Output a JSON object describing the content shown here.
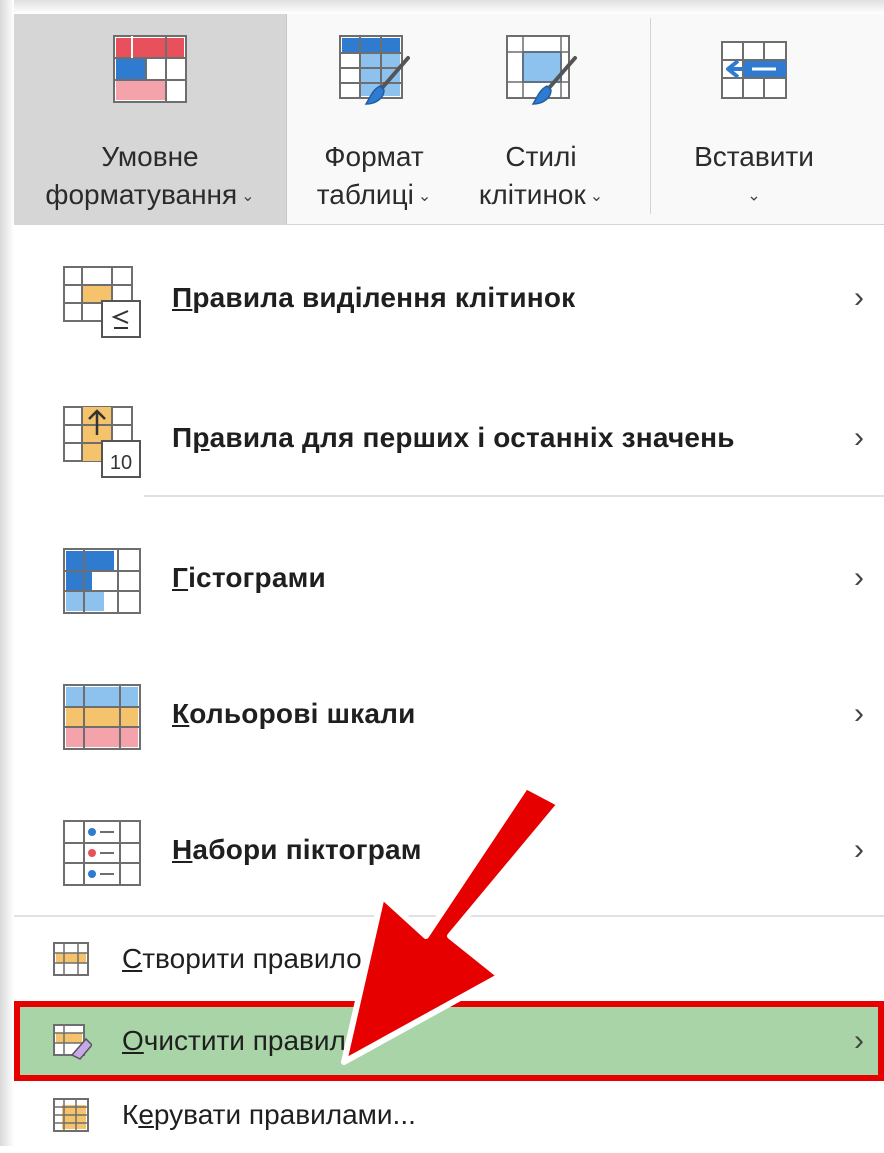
{
  "ribbon": {
    "conditional_formatting": {
      "line1": "Умовне",
      "line2": "форматування"
    },
    "format_table": {
      "line1": "Формат",
      "line2": "таблиці"
    },
    "cell_styles": {
      "line1": "Стилі",
      "line2": "клітинок"
    },
    "insert": {
      "line1": "Вставити"
    }
  },
  "menu": {
    "highlight_rules": {
      "first": "П",
      "rest": "равила виділення клітинок"
    },
    "top_bottom_rules": {
      "pre": "П",
      "mnemonic": "р",
      "rest": "авила для перших і останніх значень"
    },
    "data_bars": {
      "first": "Г",
      "rest": "істограми"
    },
    "color_scales": {
      "first": "К",
      "rest": "ольорові шкали"
    },
    "icon_sets": {
      "first": "Н",
      "rest": "абори піктограм"
    },
    "new_rule": {
      "first": "С",
      "rest": "творити правило..."
    },
    "clear_rules": {
      "first": "О",
      "rest": "чистити правила"
    },
    "manage_rules": {
      "pre": "К",
      "mnemonic": "е",
      "rest": "рувати правилами..."
    }
  },
  "icon_top_bottom_number": "10",
  "colors": {
    "highlight_bg": "#a9d4a7",
    "highlight_border": "#e60000",
    "arrow": "#e60000",
    "ribbon_active": "#d6d6d6",
    "icon_red": "#e8515c",
    "icon_blue": "#2e7bcf",
    "icon_orange": "#f4c36b"
  },
  "icons": {
    "conditional_formatting": "conditional-formatting-icon",
    "format_table": "format-table-icon",
    "cell_styles": "cell-styles-icon",
    "insert": "insert-cells-icon",
    "highlight_rules": "highlight-cells-rules-icon",
    "top_bottom_rules": "top-bottom-rules-icon",
    "data_bars": "data-bars-icon",
    "color_scales": "color-scales-icon",
    "icon_sets": "icon-sets-icon",
    "new_rule": "new-rule-icon",
    "clear_rules": "clear-rules-icon",
    "manage_rules": "manage-rules-icon",
    "chevron": "chevron-right-icon"
  }
}
